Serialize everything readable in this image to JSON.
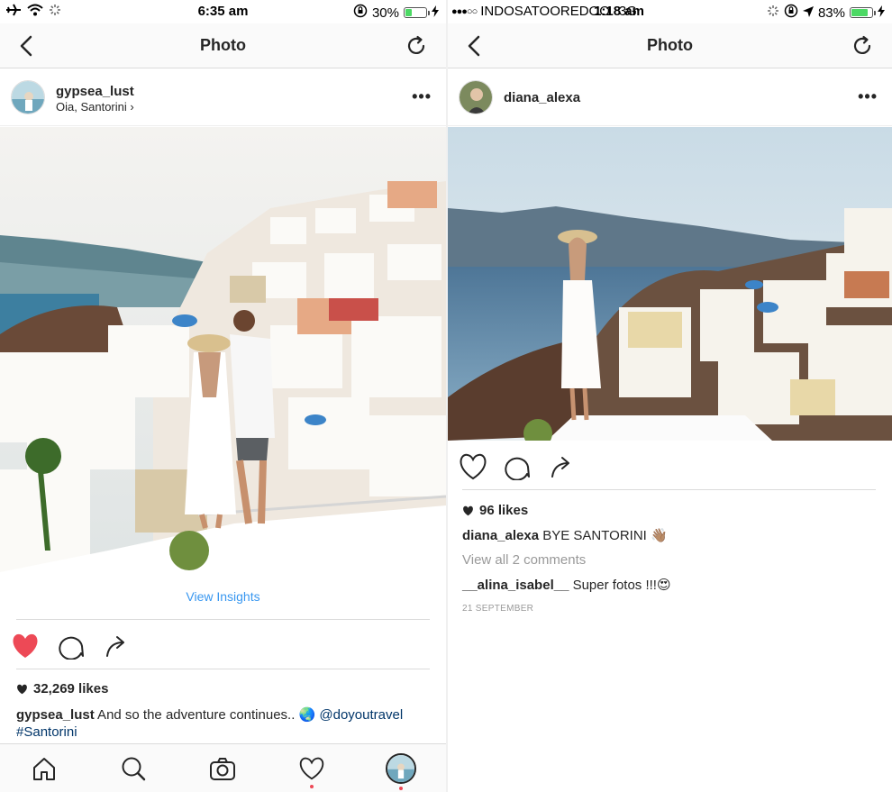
{
  "left": {
    "status": {
      "time": "6:35 am",
      "battery": "30%",
      "battery_level": 0.3
    },
    "nav_title": "Photo",
    "post": {
      "username": "gypsea_lust",
      "location": "Oia, Santorini",
      "location_chevron": "›",
      "more": "•••",
      "view_insights": "View Insights",
      "likes": "32,269 likes",
      "caption_user": "gypsea_lust",
      "caption_text": " And so the adventure continues.. 🌏 ",
      "caption_mention": "@doyoutravel",
      "caption_hashtag": "#Santorini",
      "liked": true
    },
    "tabbar": [
      "home-icon",
      "search-icon",
      "camera-icon",
      "heart-icon",
      "profile-avatar"
    ]
  },
  "right": {
    "status": {
      "signal": "●●●○○",
      "carrier": "INDOSATOOREDOO",
      "network": "3G",
      "time": "1:18 am",
      "battery": "83%",
      "battery_level": 0.83
    },
    "nav_title": "Photo",
    "post": {
      "username": "diana_alexa",
      "more": "•••",
      "likes": "96 likes",
      "caption_user": "diana_alexa",
      "caption_text": " BYE SANTORINI 👋🏽",
      "view_comments": "View all 2 comments",
      "comment_user": "__alina_isabel__",
      "comment_text": " Super fotos !!!😍",
      "date": "21 SEPTEMBER",
      "liked": false
    }
  },
  "colors": {
    "accent": "#3897f0",
    "like_red": "#ed4956",
    "sky": "#cfe0ea",
    "sea": "#5d86a6",
    "white_buildings": "#f2f0eb"
  }
}
